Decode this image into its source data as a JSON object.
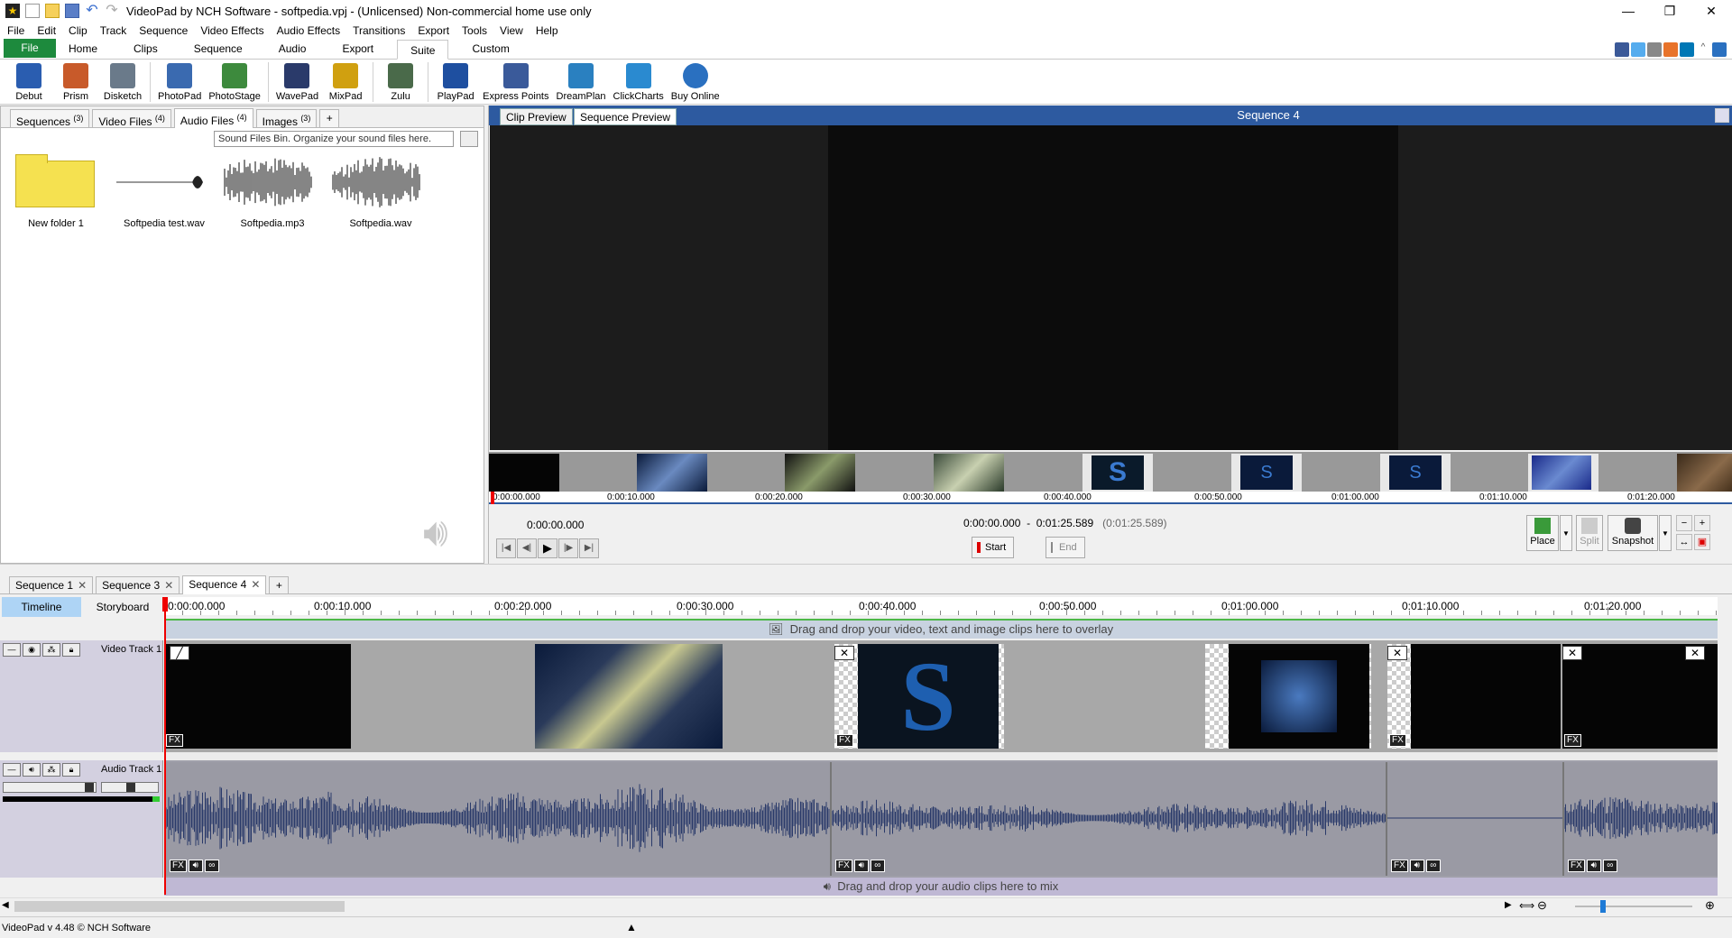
{
  "window": {
    "title": "VideoPad by NCH Software - softpedia.vpj - (Unlicensed) Non-commercial home use only"
  },
  "menu": [
    "File",
    "Edit",
    "Clip",
    "Track",
    "Sequence",
    "Video Effects",
    "Audio Effects",
    "Transitions",
    "Export",
    "Tools",
    "View",
    "Help"
  ],
  "ribbon_tabs": [
    "File",
    "Home",
    "Clips",
    "Sequence",
    "Audio",
    "Export",
    "Suite",
    "Custom"
  ],
  "active_ribbon_tab": "Suite",
  "toolbar": {
    "items": [
      {
        "label": "Debut",
        "icon": "debut-icon",
        "color": "#2a5db0"
      },
      {
        "label": "Prism",
        "icon": "prism-icon",
        "color": "#c85a2a"
      },
      {
        "label": "Disketch",
        "icon": "disketch-icon",
        "color": "#6a7a8a"
      },
      {
        "label": "PhotoPad",
        "icon": "photopad-icon",
        "color": "#3a6ab0"
      },
      {
        "label": "PhotoStage",
        "icon": "photostage-icon",
        "color": "#3d8a3d"
      },
      {
        "label": "WavePad",
        "icon": "wavepad-icon",
        "color": "#2a3a6a"
      },
      {
        "label": "MixPad",
        "icon": "mixpad-icon",
        "color": "#d0a010"
      },
      {
        "label": "Zulu",
        "icon": "zulu-icon",
        "color": "#4a6a4a"
      },
      {
        "label": "PlayPad",
        "icon": "playpad-icon",
        "color": "#1e4fa0"
      },
      {
        "label": "Express Points",
        "icon": "express-points-icon",
        "color": "#3a5a9a"
      },
      {
        "label": "DreamPlan",
        "icon": "dreamplan-icon",
        "color": "#2a80c0"
      },
      {
        "label": "ClickCharts",
        "icon": "clickcharts-icon",
        "color": "#2a8ad0"
      },
      {
        "label": "Buy Online",
        "icon": "buy-online-icon",
        "color": "#2a70c0"
      }
    ]
  },
  "bin": {
    "tabs": [
      {
        "label": "Sequences",
        "count": "(3)"
      },
      {
        "label": "Video Files",
        "count": "(4)"
      },
      {
        "label": "Audio Files",
        "count": "(4)"
      },
      {
        "label": "Images",
        "count": "(3)"
      }
    ],
    "active_tab": "Audio Files",
    "add_tab": "+",
    "tooltip": "Sound Files Bin. Organize your sound files here.",
    "items": [
      {
        "label": "New folder 1",
        "type": "folder"
      },
      {
        "label": "Softpedia test.wav",
        "type": "audio"
      },
      {
        "label": "Softpedia.mp3",
        "type": "audio"
      },
      {
        "label": "Softpedia.wav",
        "type": "audio"
      }
    ]
  },
  "preview": {
    "tabs": [
      "Clip Preview",
      "Sequence Preview"
    ],
    "active_tab": "Sequence Preview",
    "title": "Sequence 4",
    "ruler_labels": [
      "0:00:00.000",
      "0:00:10.000",
      "0:00:20.000",
      "0:00:30.000",
      "0:00:40.000",
      "0:00:50.000",
      "0:01:00.000",
      "0:01:10.000",
      "0:01:20.000"
    ],
    "current_time": "0:00:00.000",
    "range_start": "0:00:00.000",
    "range_sep": "-",
    "range_end": "0:01:25.589",
    "range_duration": "(0:01:25.589)",
    "start_label": "Start",
    "end_label": "End",
    "place_label": "Place",
    "split_label": "Split",
    "snapshot_label": "Snapshot"
  },
  "sequence_tabs": [
    {
      "label": "Sequence 1"
    },
    {
      "label": "Sequence 3"
    },
    {
      "label": "Sequence 4"
    }
  ],
  "active_sequence": "Sequence 4",
  "timeline": {
    "modes": [
      "Timeline",
      "Storyboard"
    ],
    "active_mode": "Timeline",
    "ruler_labels": [
      "0:00:00.000",
      "0:00:10.000",
      "0:00:20.000",
      "0:00:30.000",
      "0:00:40.000",
      "0:00:50.000",
      "0:01:00.000",
      "0:01:10.000",
      "0:01:20.000"
    ],
    "overlay_hint": "Drag and drop your video, text and image clips here to overlay",
    "video_track_name": "Video Track 1",
    "audio_track_name": "Audio Track 1",
    "mix_hint": "Drag and drop your audio clips here to mix",
    "fx_label": "FX"
  },
  "status": {
    "text": "VideoPad v 4.48 © NCH Software"
  },
  "colors": {
    "accent": "#2d5aa0",
    "file_tab": "#1d8a3d",
    "playhead": "#e00000",
    "overlay_border": "#4db848"
  }
}
